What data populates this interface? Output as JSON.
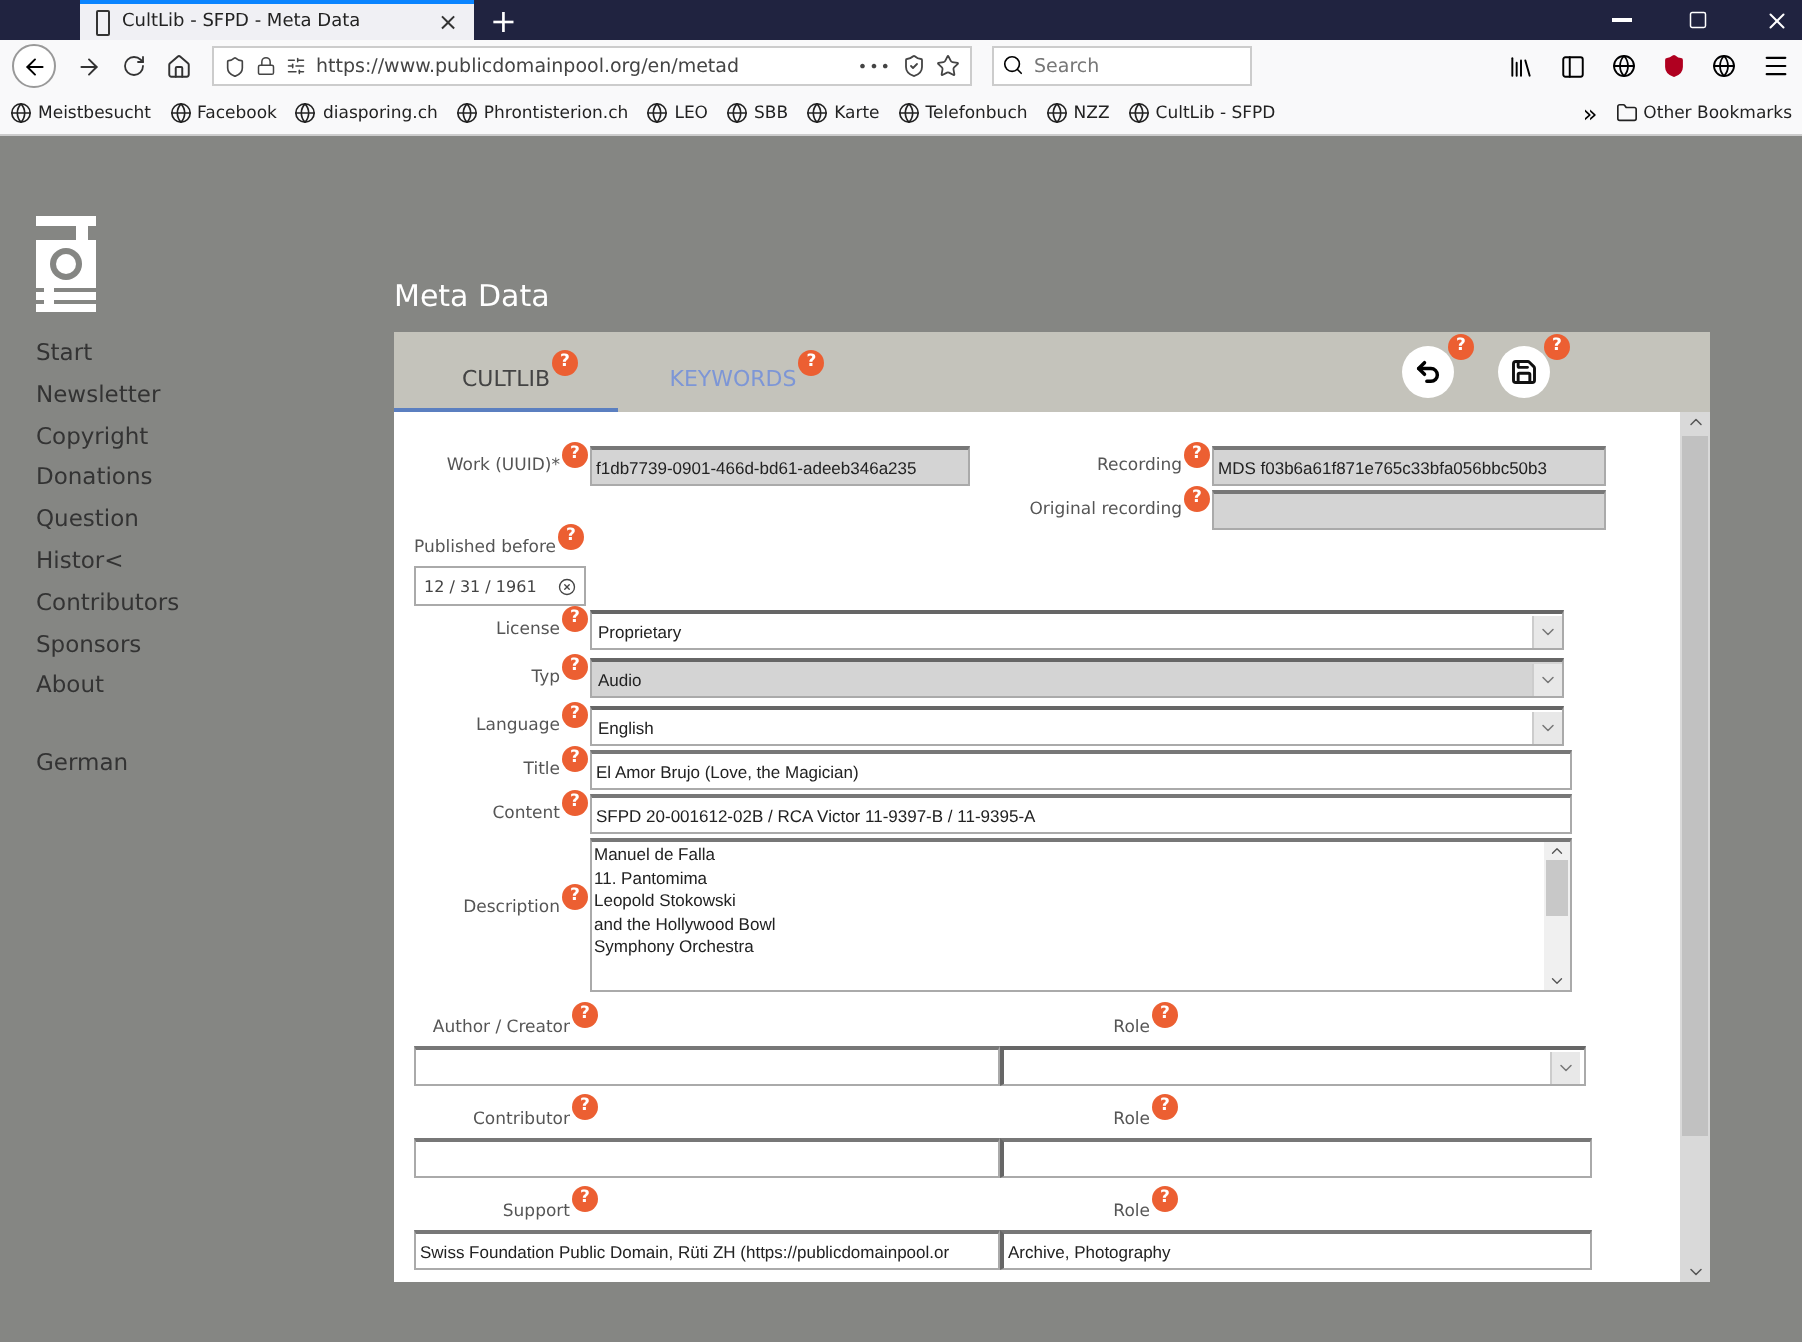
{
  "browser": {
    "tab": {
      "title": "CultLib - SFPD - Meta Data",
      "close": "×",
      "selected": true
    },
    "new_tab": "+",
    "url": "https://www.publicdomainpool.org/en/metad",
    "more": "•••",
    "search": {
      "placeholder": "Search"
    },
    "bookmarks": [
      {
        "label": "Meistbesucht"
      },
      {
        "label": "Facebook"
      },
      {
        "label": "diasporing.ch"
      },
      {
        "label": "Phrontisterion.ch"
      },
      {
        "label": "LEO"
      },
      {
        "label": "SBB"
      },
      {
        "label": "Karte"
      },
      {
        "label": "Telefonbuch"
      },
      {
        "label": "NZZ"
      },
      {
        "label": "CultLib - SFPD"
      }
    ],
    "overflow": "»",
    "other_bookmarks": "Other Bookmarks"
  },
  "sidebar": {
    "items": [
      {
        "label": "Start"
      },
      {
        "label": "Newsletter"
      },
      {
        "label": "Copyright"
      },
      {
        "label": "Donations"
      },
      {
        "label": "Question"
      },
      {
        "label": "Histor<"
      },
      {
        "label": "Contributors"
      },
      {
        "label": "Sponsors"
      },
      {
        "label": "About"
      }
    ],
    "language": "German"
  },
  "page": {
    "title": "Meta Data"
  },
  "tabs": [
    {
      "label": "CULTLIB",
      "help": "?",
      "selected": true
    },
    {
      "label": "KEYWORDS",
      "help": "?",
      "selected": false
    }
  ],
  "actions": [
    {
      "kind": "undo",
      "help": "?"
    },
    {
      "kind": "save",
      "help": "?"
    }
  ],
  "ids": {
    "work": {
      "label": "Work (UUID)*",
      "help": "?",
      "value": "f1db7739-0901-466d-bd61-adeeb346a235"
    },
    "recording": {
      "label": "Recording",
      "help": "?",
      "value": "MDS f03b6a61f871e765c33bfa056bbc50b3"
    },
    "original_recording": {
      "label": "Original recording",
      "help": "?"
    }
  },
  "published": {
    "label": "Published before",
    "help": "?",
    "value": "12 / 31 / 1961"
  },
  "rows": [
    {
      "kind": "select",
      "label": "License",
      "help": "?",
      "value": "Proprietary",
      "disabled": false
    },
    {
      "kind": "select",
      "label": "Typ",
      "help": "?",
      "value": "Audio",
      "disabled": true
    },
    {
      "kind": "select",
      "label": "Language",
      "help": "?",
      "value": "English",
      "disabled": false
    },
    {
      "kind": "text",
      "label": "Title",
      "help": "?",
      "value": "El Amor Brujo (Love, the Magician)"
    },
    {
      "kind": "text",
      "label": "Content",
      "help": "?",
      "value": "SFPD 20-001612-02B / RCA Victor 11-9397-B / 11-9395-A"
    },
    {
      "kind": "textarea",
      "label": "Description",
      "help": "?",
      "lines": [
        "Manuel de Falla",
        "11. Pantomima",
        "Leopold Stokowski",
        "and the Hollywood Bowl",
        "Symphony Orchestra"
      ]
    }
  ],
  "people": [
    {
      "label": "Author / Creator",
      "help": "?",
      "role": {
        "label": "Role",
        "help": "?",
        "kind": "select"
      }
    },
    {
      "label": "Contributor",
      "help": "?",
      "role": {
        "label": "Role",
        "help": "?",
        "kind": "text"
      }
    },
    {
      "label": "Support",
      "help": "?",
      "value": "Swiss Foundation Public Domain, Rüti ZH (https://publicdomainpool.or",
      "role": {
        "label": "Role",
        "help": "?",
        "kind": "text",
        "value": "Archive, Photography"
      }
    }
  ]
}
